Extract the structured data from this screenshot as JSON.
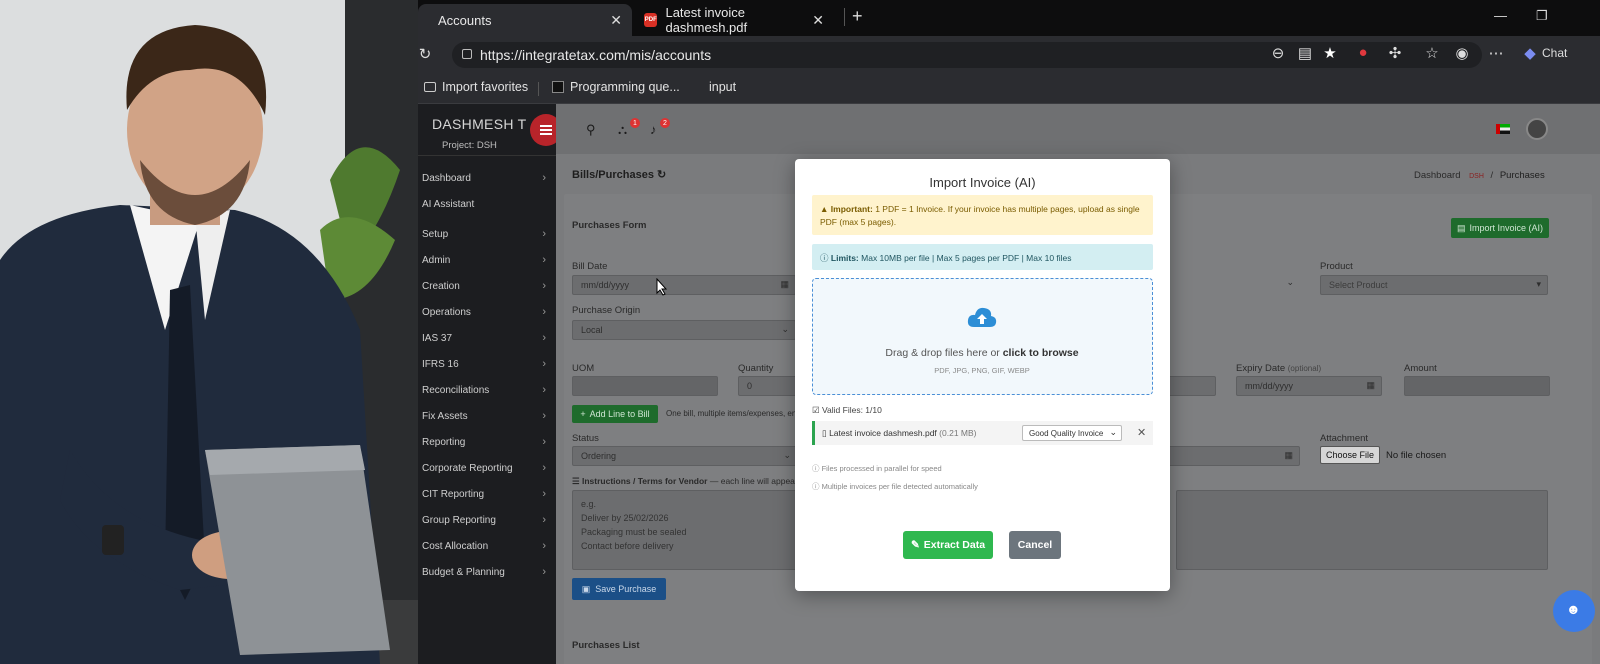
{
  "browser": {
    "tabs": [
      {
        "label": "Accounts",
        "active": true
      },
      {
        "label": "Latest invoice dashmesh.pdf",
        "active": false
      }
    ],
    "url": "https://integratetax.com/mis/accounts",
    "copilot_label": "Chat",
    "favorites": [
      "Import favorites",
      "Programming que...",
      "input"
    ]
  },
  "sidebar": {
    "brand": "DASHMESH T",
    "project": "Project: DSH",
    "items": [
      "Dashboard",
      "AI Assistant",
      "Setup",
      "Admin",
      "Creation",
      "Operations",
      "IAS 37",
      "IFRS 16",
      "Reconciliations",
      "Fix Assets",
      "Reporting",
      "Corporate Reporting",
      "CIT Reporting",
      "Group Reporting",
      "Cost Allocation",
      "Budget & Planning"
    ]
  },
  "topnav": {
    "badges": [
      "1",
      "2"
    ]
  },
  "page": {
    "title": "Bills/Purchases",
    "breadcrumb": [
      "Dashboard",
      "DSH",
      "Purchases"
    ],
    "form_title": "Purchases Form",
    "import_button": "Import Invoice (AI)",
    "fields": {
      "bill_date_label": "Bill Date",
      "bill_date_placeholder": "mm/dd/yyyy",
      "purchase_origin_label": "Purchase Origin",
      "purchase_origin_value": "Local",
      "product_label": "Product",
      "product_placeholder": "Select Product",
      "uom_label": "UOM",
      "quantity_label": "Quantity",
      "quantity_value": "0",
      "expiry_label": "Expiry Date",
      "expiry_optional": "(optional)",
      "expiry_placeholder": "mm/dd/yyyy",
      "amount_label": "Amount",
      "add_line": "Add Line to Bill",
      "add_line_note": "One bill, multiple items/expenses, en",
      "status_label": "Status",
      "status_value": "Ordering",
      "attachment_label": "Attachment",
      "choose_file": "Choose File",
      "no_file": "No file chosen",
      "instructions_label": "Instructions / Terms for Vendor",
      "instructions_note": "— each line will appear",
      "instructions_lines": [
        "e.g.",
        "Deliver by 25/02/2026",
        "Packaging must be sealed",
        "Contact before delivery"
      ],
      "save_button": "Save Purchase",
      "list_title": "Purchases List"
    }
  },
  "modal": {
    "title": "Import Invoice (AI)",
    "important_label": "Important:",
    "important_text": "1 PDF = 1 Invoice. If your invoice has multiple pages, upload as single PDF (max 5 pages).",
    "limits_label": "Limits:",
    "limits_text": "Max 10MB per file | Max 5 pages per PDF | Max 10 files",
    "dropzone_text": "Drag & drop files here or",
    "dropzone_link": "click to browse",
    "dropzone_types": "PDF, JPG, PNG, GIF, WEBP",
    "valid_files": "Valid Files: 1/10",
    "file_name": "Latest invoice dashmesh.pdf",
    "file_size": "(0.21 MB)",
    "quality": "Good Quality Invoice",
    "notes": [
      "Files processed in parallel for speed",
      "Multiple invoices per file detected automatically"
    ],
    "extract_button": "Extract Data",
    "cancel_button": "Cancel"
  },
  "colors": {
    "accent_green": "#2fb84f",
    "brand_red": "#b8242a",
    "info_blue": "#3b7be6"
  }
}
